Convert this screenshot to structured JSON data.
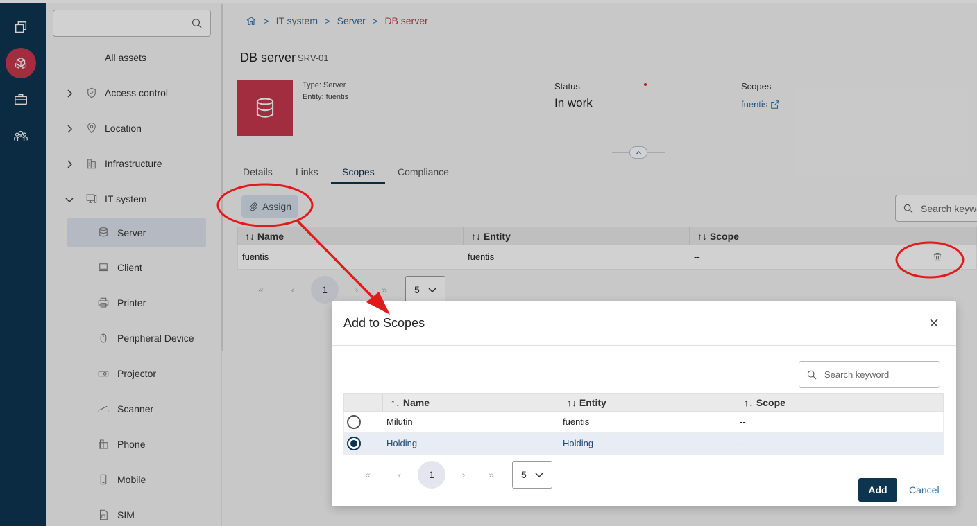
{
  "rail": {
    "items": [
      {
        "icon": "copy-stack-icon"
      },
      {
        "icon": "assets-cubes-icon",
        "active": true
      },
      {
        "icon": "briefcase-icon"
      },
      {
        "icon": "people-icon"
      }
    ]
  },
  "sidebar": {
    "search": {
      "placeholder": "",
      "icon": "search-icon"
    },
    "all_assets": "All assets",
    "items": [
      {
        "label": "Access control",
        "icon": "shield-icon",
        "expanded": false
      },
      {
        "label": "Location",
        "icon": "location-pin-icon",
        "expanded": false
      },
      {
        "label": "Infrastructure",
        "icon": "building-icon",
        "expanded": false
      },
      {
        "label": "IT system",
        "icon": "monitor-icon",
        "expanded": true
      }
    ],
    "sub_items": [
      {
        "label": "Server",
        "icon": "database-icon",
        "selected": true
      },
      {
        "label": "Client",
        "icon": "laptop-icon"
      },
      {
        "label": "Printer",
        "icon": "printer-icon"
      },
      {
        "label": "Peripheral Device",
        "icon": "mouse-icon"
      },
      {
        "label": "Projector",
        "icon": "projector-icon"
      },
      {
        "label": "Scanner",
        "icon": "scanner-icon"
      },
      {
        "label": "Phone",
        "icon": "phone-icon"
      },
      {
        "label": "Mobile",
        "icon": "mobile-icon"
      },
      {
        "label": "SIM",
        "icon": "sim-card-icon"
      }
    ]
  },
  "breadcrumb": {
    "home_icon": "home-icon",
    "items": [
      "IT system",
      "Server"
    ],
    "current": "DB server"
  },
  "asset": {
    "title": "DB server",
    "code": "SRV-01",
    "type_label": "Type:",
    "type_value": "Server",
    "entity_label": "Entity:",
    "entity_value": "fuentis",
    "status_label": "Status",
    "status_value": "In work",
    "scopes_label": "Scopes",
    "scopes_value": "fuentis",
    "tile_color": "#c6384e"
  },
  "tabs": [
    "Details",
    "Links",
    "Scopes",
    "Compliance"
  ],
  "active_tab": "Scopes",
  "scopes_panel": {
    "assign_label": "Assign",
    "search_placeholder": "Search keyword",
    "columns": [
      "Name",
      "Entity",
      "Scope"
    ],
    "rows": [
      {
        "name": "fuentis",
        "entity": "fuentis",
        "scope": "--"
      }
    ],
    "pager": {
      "first": "«",
      "prev": "‹",
      "current": "1",
      "next": "›",
      "last": "»",
      "page_size": "5"
    }
  },
  "modal": {
    "title": "Add to Scopes",
    "search_placeholder": "Search keyword",
    "columns": [
      "Name",
      "Entity",
      "Scope"
    ],
    "rows": [
      {
        "name": "Milutin",
        "entity": "fuentis",
        "scope": "--",
        "selected": false
      },
      {
        "name": "Holding",
        "entity": "Holding",
        "scope": "--",
        "selected": true
      }
    ],
    "pager": {
      "first": "«",
      "prev": "‹",
      "current": "1",
      "next": "›",
      "last": "»",
      "page_size": "5"
    },
    "add_label": "Add",
    "cancel_label": "Cancel"
  },
  "colors": {
    "rail": "#0d3550",
    "accent": "#c6384e",
    "link": "#2b6ea6",
    "primary_button": "#0d3550",
    "annotation": "#e01b1b"
  }
}
